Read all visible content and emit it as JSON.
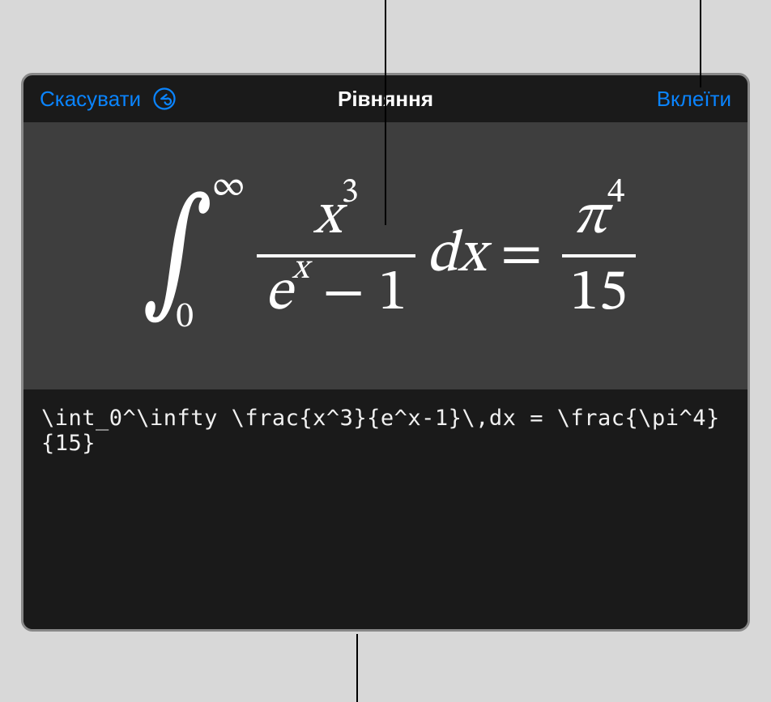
{
  "header": {
    "cancel_label": "Скасувати",
    "title": "Рівняння",
    "insert_label": "Вклеїти"
  },
  "equation": {
    "int_upper": "∞",
    "int_lower": "0",
    "frac1_num_base": "x",
    "frac1_num_exp": "3",
    "frac1_den_base": "e",
    "frac1_den_exp": "x",
    "frac1_den_tail": " − 1",
    "dx": "dx",
    "equals": "=",
    "frac2_num_base": "π",
    "frac2_num_exp": "4",
    "frac2_den": "15"
  },
  "latex_source": "\\int_0^\\infty \\frac{x^3}{e^x-1}\\,dx = \\frac{\\pi^4}{15}"
}
